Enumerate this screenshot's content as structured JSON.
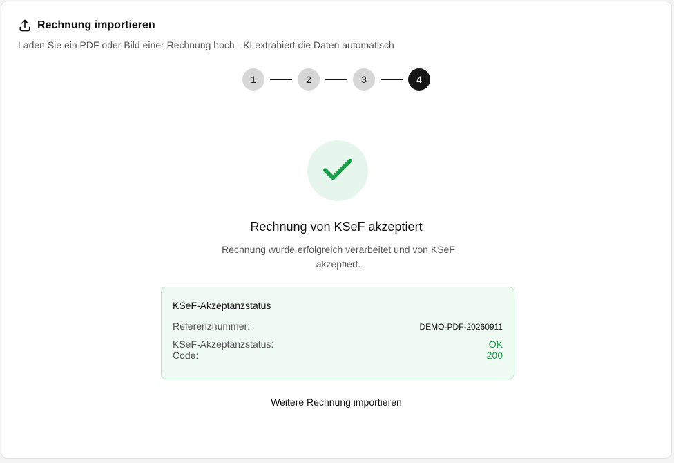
{
  "header": {
    "title": "Rechnung importieren",
    "subtitle": "Laden Sie ein PDF oder Bild einer Rechnung hoch - KI extrahiert die Daten automatisch",
    "icon": "upload-icon"
  },
  "stepper": {
    "steps": [
      "1",
      "2",
      "3",
      "4"
    ],
    "current": 4
  },
  "result": {
    "icon": "check-icon",
    "title": "Rechnung von KSeF akzeptiert",
    "description": "Rechnung wurde erfolgreich verarbeitet und von KSeF akzeptiert."
  },
  "status": {
    "heading": "KSeF-Akzeptanzstatus",
    "reference_label": "Referenznummer:",
    "reference_value": "DEMO-PDF-20260911",
    "status_label": "KSeF-Akzeptanzstatus:",
    "status_value": "OK",
    "code_label": "Code:",
    "code_value": "200"
  },
  "actions": {
    "import_another": "Weitere Rechnung importieren"
  },
  "colors": {
    "success": "#1aa04a",
    "success_bg": "#effaf2",
    "active_step": "#151515"
  }
}
